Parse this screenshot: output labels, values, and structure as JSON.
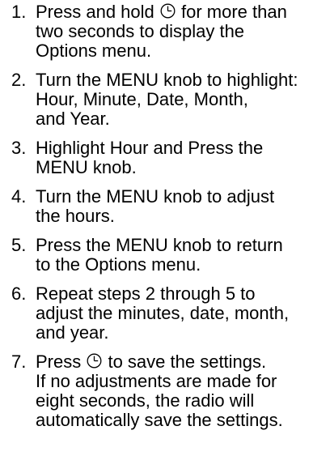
{
  "steps": [
    {
      "number": "1.",
      "lines": [
        {
          "pre": "Press and hold ",
          "icon": "clock-icon",
          "post": " for more than"
        },
        {
          "text": "two seconds to display the"
        },
        {
          "text": "Options menu."
        }
      ]
    },
    {
      "number": "2.",
      "lines": [
        {
          "text": "Turn the MENU knob to highlight:"
        },
        {
          "text": "Hour, Minute, Date, Month,"
        },
        {
          "text": "and Year."
        }
      ]
    },
    {
      "number": "3.",
      "lines": [
        {
          "text": "Highlight Hour and Press the"
        },
        {
          "text": "MENU knob."
        }
      ]
    },
    {
      "number": "4.",
      "lines": [
        {
          "text": "Turn the MENU knob to adjust"
        },
        {
          "text": "the hours."
        }
      ]
    },
    {
      "number": "5.",
      "lines": [
        {
          "text": "Press the MENU knob to return"
        },
        {
          "text": "to the Options menu."
        }
      ]
    },
    {
      "number": "6.",
      "lines": [
        {
          "text": "Repeat steps 2 through 5 to"
        },
        {
          "text": "adjust the minutes, date, month,"
        },
        {
          "text": "and year."
        }
      ]
    },
    {
      "number": "7.",
      "lines": [
        {
          "pre": "Press ",
          "icon": "clock-icon",
          "post": " to save the settings."
        },
        {
          "text": "If no adjustments are made for"
        },
        {
          "text": "eight seconds, the radio will"
        },
        {
          "text": "automatically save the settings."
        }
      ]
    }
  ]
}
